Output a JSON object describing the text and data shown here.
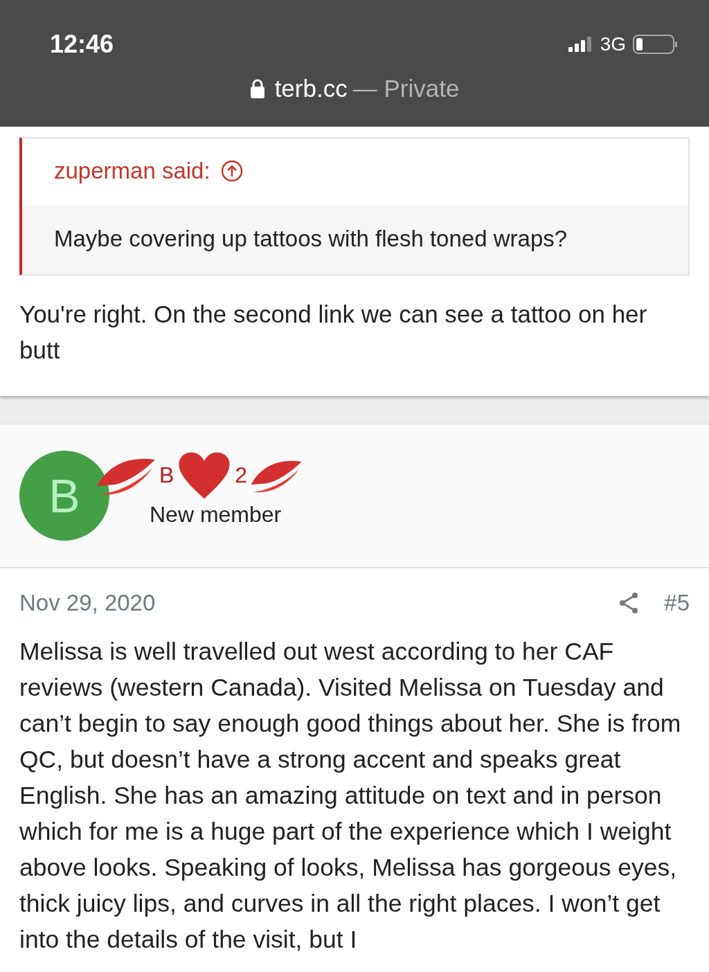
{
  "status_bar": {
    "time": "12:46",
    "network": "3G"
  },
  "address_bar": {
    "domain": "terb.cc",
    "mode": "— Private"
  },
  "quote": {
    "author": "zuperman said:",
    "text": "Maybe covering up tattoos with flesh toned wraps?"
  },
  "reply_text": "You're right. On the second link we can see a tattoo on her butt",
  "post": {
    "avatar_letter": "B",
    "username_parts": [
      "B",
      "2"
    ],
    "user_title": "New member",
    "date": "Nov 29, 2020",
    "number": "#5",
    "body": "Melissa is well travelled out west according to her CAF reviews (western Canada). Visited Melissa on Tuesday and can’t begin to say enough good things about her. She is from QC, but doesn’t have a strong accent and speaks great English. She has an amazing attitude on text and in person which for me is a huge part of the experience which I weight above looks. Speaking of looks, Melissa has gorgeous eyes, thick juicy lips, and curves in all the right places. I won’t get into the details of the visit, but I"
  }
}
